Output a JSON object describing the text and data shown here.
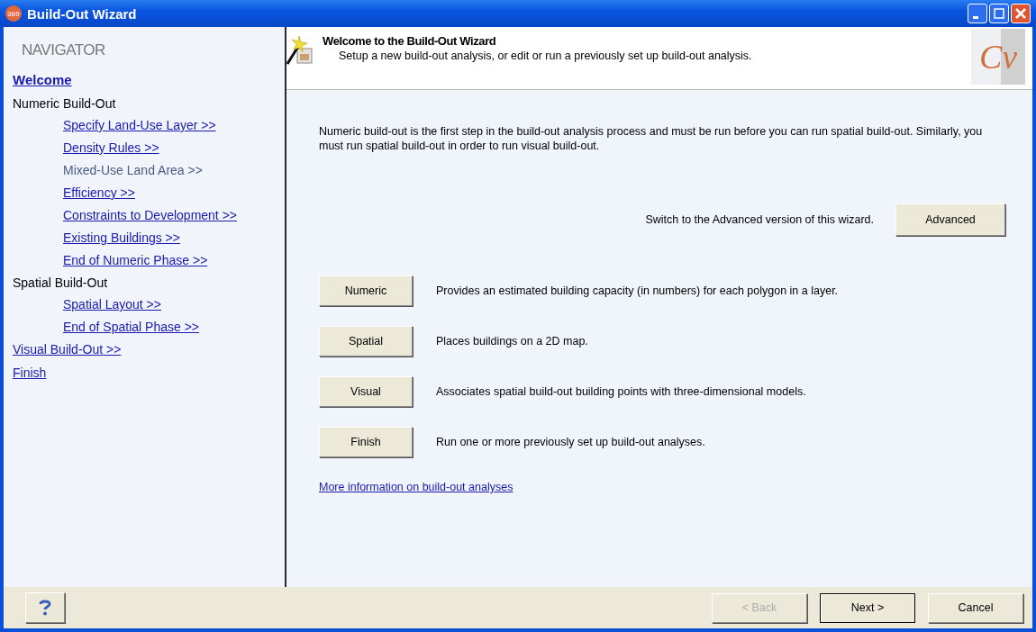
{
  "window": {
    "title": "Build-Out Wizard",
    "app_badge": "360"
  },
  "navigator": {
    "title": "NAVIGATOR",
    "items": [
      {
        "label": "Welcome",
        "kind": "link",
        "selected": true
      },
      {
        "label": "Numeric Build-Out",
        "kind": "group",
        "children": [
          {
            "label": "Specify Land-Use Layer >>",
            "disabled": false
          },
          {
            "label": "Density Rules >>",
            "disabled": false
          },
          {
            "label": "Mixed-Use Land Area >>",
            "disabled": true
          },
          {
            "label": "Efficiency >>",
            "disabled": false
          },
          {
            "label": "Constraints to Development >>",
            "disabled": false
          },
          {
            "label": "Existing Buildings >>",
            "disabled": false
          },
          {
            "label": "End of Numeric Phase >>",
            "disabled": false
          }
        ]
      },
      {
        "label": "Spatial Build-Out",
        "kind": "group",
        "children": [
          {
            "label": "Spatial Layout >>",
            "disabled": false
          },
          {
            "label": "End of Spatial Phase >>",
            "disabled": false
          }
        ]
      },
      {
        "label": "Visual Build-Out >>",
        "kind": "link",
        "selected": false
      },
      {
        "label": "Finish",
        "kind": "link",
        "selected": false
      }
    ]
  },
  "header": {
    "title": "Welcome to the Build-Out Wizard",
    "subtitle": "Setup a new build-out analysis, or edit or run a previously set up build-out analysis.",
    "logo_text": "Cv"
  },
  "intro": "Numeric build-out is the first step in the build-out analysis process and must be run before you can run spatial build-out. Similarly, you must run spatial build-out in order to run visual build-out.",
  "advanced": {
    "text": "Switch to the Advanced version of this wizard.",
    "button": "Advanced"
  },
  "options": [
    {
      "button": "Numeric",
      "description": "Provides an estimated building capacity (in numbers) for each polygon in a layer."
    },
    {
      "button": "Spatial",
      "description": "Places buildings on a 2D map."
    },
    {
      "button": "Visual",
      "description": "Associates spatial build-out building points with three-dimensional models."
    },
    {
      "button": "Finish",
      "description": "Run one or more previously set up build-out analyses."
    }
  ],
  "more_link": "More information on build-out analyses",
  "footer": {
    "buttons": [
      {
        "label": "< Back",
        "disabled": true,
        "default": false
      },
      {
        "label": "Next >",
        "disabled": false,
        "default": true
      },
      {
        "label": "Cancel",
        "disabled": false,
        "default": false
      }
    ]
  }
}
